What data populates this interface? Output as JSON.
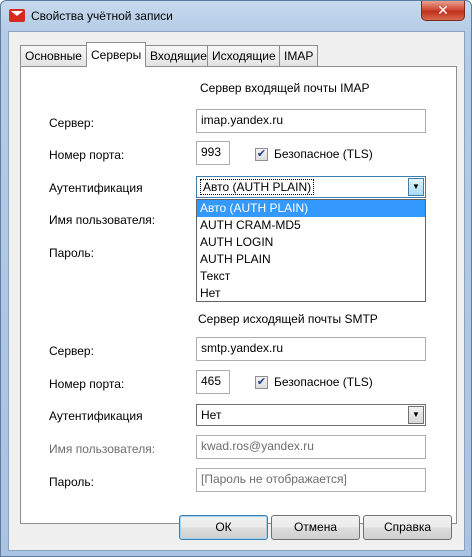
{
  "window": {
    "title": "Свойства учётной записи",
    "close_label": "✕"
  },
  "tabs": [
    {
      "label": "Основные",
      "active": false
    },
    {
      "label": "Серверы",
      "active": true
    },
    {
      "label": "Входящие",
      "active": false
    },
    {
      "label": "Исходящие",
      "active": false
    },
    {
      "label": "IMAP",
      "active": false
    }
  ],
  "incoming": {
    "section_title": "Сервер входящей почты IMAP",
    "server_label": "Сервер:",
    "server_value": "imap.yandex.ru",
    "port_label": "Номер порта:",
    "port_value": "993",
    "secure_label": "Безопасное (TLS)",
    "secure_checked": true,
    "auth_label": "Аутентификация",
    "auth_value": "Авто  (AUTH PLAIN)",
    "username_label": "Имя пользователя:",
    "password_label": "Пароль:"
  },
  "auth_dropdown": {
    "options": [
      "Авто  (AUTH PLAIN)",
      "AUTH CRAM-MD5",
      "AUTH LOGIN",
      "AUTH PLAIN",
      "Текст",
      "Нет"
    ],
    "highlighted_index": 0
  },
  "outgoing": {
    "section_title": "Сервер исходящей почты SMTP",
    "server_label": "Сервер:",
    "server_value": "smtp.yandex.ru",
    "port_label": "Номер порта:",
    "port_value": "465",
    "secure_label": "Безопасное (TLS)",
    "secure_checked": true,
    "auth_label": "Аутентификация",
    "auth_value": "Нет",
    "username_label": "Имя пользователя:",
    "username_value": "kwad.ros@yandex.ru",
    "password_label": "Пароль:",
    "password_value": "[Пароль не отображается]"
  },
  "buttons": {
    "ok": "ОК",
    "cancel": "Отмена",
    "help": "Справка"
  },
  "icons": {
    "check": "✔",
    "dropdown_arrow": "▼"
  },
  "colors": {
    "selection": "#3399ff",
    "title_bar": "#b4cbe6",
    "close_button": "#c0311c"
  }
}
